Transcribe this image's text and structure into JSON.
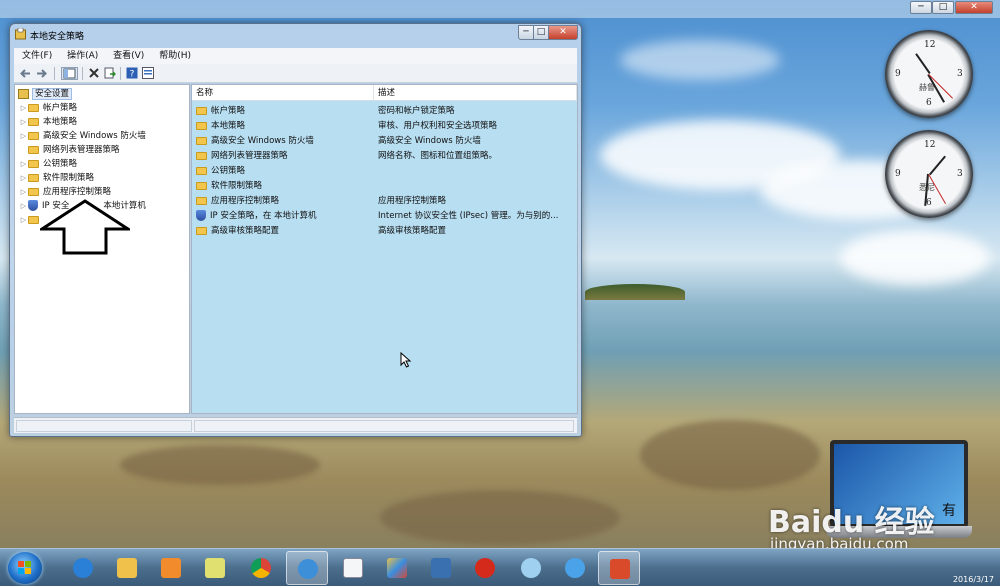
{
  "window": {
    "title": "本地安全策略",
    "minimize": "─",
    "maximize": "□",
    "close": "✕"
  },
  "menu": [
    "文件(F)",
    "操作(A)",
    "查看(V)",
    "帮助(H)"
  ],
  "toolbar": {
    "back_icon": "arrow-left-icon",
    "forward_icon": "arrow-right-icon",
    "show_hide_tree_icon": "console-tree-icon",
    "delete_icon": "delete-icon",
    "export_icon": "export-list-icon",
    "help_icon": "help-icon",
    "properties_icon": "properties-icon"
  },
  "tree": {
    "root": "安全设置",
    "items": [
      {
        "label": "帐户策略",
        "icon": "folder-lock"
      },
      {
        "label": "本地策略",
        "icon": "folder-lock"
      },
      {
        "label": "高级安全 Windows 防火墙",
        "icon": "folder"
      },
      {
        "label": "网络列表管理器策略",
        "icon": "folder"
      },
      {
        "label": "公钥策略",
        "icon": "folder"
      },
      {
        "label": "软件限制策略",
        "icon": "folder"
      },
      {
        "label": "应用程序控制策略",
        "icon": "folder"
      },
      {
        "label": "IP 安全",
        "label_suffix": "本地计算机",
        "icon": "shield"
      },
      {
        "label": "",
        "icon": "folder"
      }
    ]
  },
  "list": {
    "columns": [
      "名称",
      "描述"
    ],
    "rows": [
      {
        "name": "帐户策略",
        "desc": "密码和帐户锁定策略"
      },
      {
        "name": "本地策略",
        "desc": "审核、用户权利和安全选项策略"
      },
      {
        "name": "高级安全 Windows 防火墙",
        "desc": "高级安全 Windows 防火墙"
      },
      {
        "name": "网络列表管理器策略",
        "desc": "网络名称、图标和位置组策略。"
      },
      {
        "name": "公钥策略",
        "desc": ""
      },
      {
        "name": "软件限制策略",
        "desc": ""
      },
      {
        "name": "应用程序控制策略",
        "desc": "应用程序控制策略"
      },
      {
        "name": "IP 安全策略，在 本地计算机",
        "desc": "Internet 协议安全性 (IPsec) 管理。为与别的..."
      },
      {
        "name": "高级审核策略配置",
        "desc": "高级审核策略配置"
      }
    ]
  },
  "clocks": [
    {
      "numbers": [
        "12",
        "3",
        "6",
        "9"
      ],
      "place": "赫鲁"
    },
    {
      "numbers": [
        "12",
        "3",
        "6",
        "9"
      ],
      "place": "悉尼"
    }
  ],
  "watermark": {
    "brand": "Baidu 经验",
    "url": "jingyan.baidu.com",
    "laptop_text": "有"
  },
  "taskbar": {
    "apps": [
      "internet-explorer-icon",
      "file-explorer-icon",
      "media-player-icon",
      "chrome-icon",
      "browser-icon",
      "document-icon",
      "paint-icon",
      "remote-desktop-icon",
      "chess-icon",
      "game-icon",
      "network-icon",
      "local-security-policy-icon"
    ],
    "date": "2016/3/17"
  },
  "colors": {
    "list_background": "#b8def2",
    "selection": "#dfe9f7"
  }
}
